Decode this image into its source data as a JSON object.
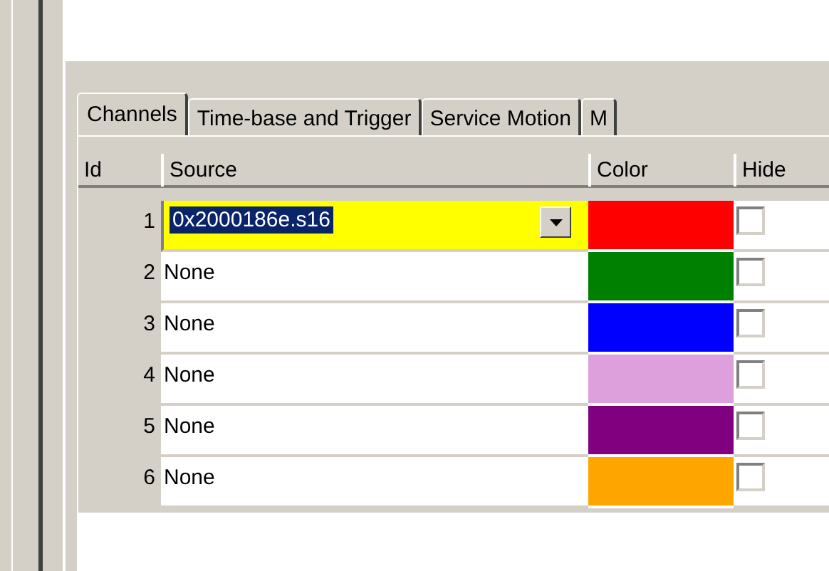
{
  "tabs": [
    {
      "label": "Channels",
      "selected": true
    },
    {
      "label": "Time-base and Trigger",
      "selected": false
    },
    {
      "label": "Service Motion",
      "selected": false
    },
    {
      "label": "M",
      "selected": false
    }
  ],
  "table": {
    "columns": [
      "Id",
      "Source",
      "Color",
      "Hide"
    ],
    "rows": [
      {
        "id": "1",
        "source": "0x2000186e.s16",
        "editing": true,
        "color": "#ff0000",
        "hidden": false
      },
      {
        "id": "2",
        "source": "None",
        "editing": false,
        "color": "#008000",
        "hidden": false
      },
      {
        "id": "3",
        "source": "None",
        "editing": false,
        "color": "#0000ff",
        "hidden": false
      },
      {
        "id": "4",
        "source": "None",
        "editing": false,
        "color": "#dda0dd",
        "hidden": false
      },
      {
        "id": "5",
        "source": "None",
        "editing": false,
        "color": "#800080",
        "hidden": false
      },
      {
        "id": "6",
        "source": "None",
        "editing": false,
        "color": "#ffa500",
        "hidden": false
      }
    ]
  }
}
